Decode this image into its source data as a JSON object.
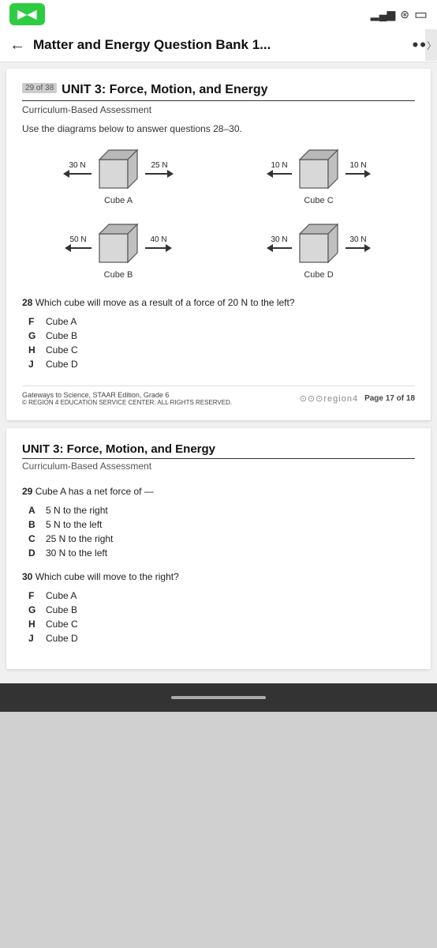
{
  "statusBar": {
    "videoLabel": "▶◀",
    "signal": "▂▄▆",
    "wifi": "⇡",
    "battery": "▭"
  },
  "navBar": {
    "backArrow": "←",
    "title": "Matter and Energy Question Bank 1...",
    "dots": "••",
    "chevron": "〉"
  },
  "page1": {
    "pageBadge": "29 of 38",
    "unitTitle": "UNIT 3: Force, Motion, and Energy",
    "subtitle": "Curriculum-Based Assessment",
    "instructions": "Use the diagrams below to answer questions 28–30.",
    "cubeA": {
      "label": "Cube A",
      "leftForce": "30 N",
      "rightForce": "25 N"
    },
    "cubeC": {
      "label": "Cube C",
      "leftForce": "10 N",
      "rightForce": "10 N"
    },
    "cubeB": {
      "label": "Cube B",
      "leftForce": "50 N",
      "rightForce": "40 N"
    },
    "cubeD": {
      "label": "Cube D",
      "leftForce": "30 N",
      "rightForce": "30 N"
    },
    "q28": {
      "num": "28",
      "text": "Which cube will move as a result of a force of 20 N to the left?",
      "options": [
        {
          "letter": "F",
          "text": "Cube A"
        },
        {
          "letter": "G",
          "text": "Cube B"
        },
        {
          "letter": "H",
          "text": "Cube C"
        },
        {
          "letter": "J",
          "text": "Cube D"
        }
      ]
    },
    "footer": {
      "left": "Gateways to Science, STAAR Edition, Grade 6",
      "copy": "© REGION 4 EDUCATION SERVICE CENTER. ALL RIGHTS RESERVED.",
      "logo": "⊙⊙⊙region4",
      "pageNum": "Page 17 of 18"
    }
  },
  "page2": {
    "unitTitle": "UNIT 3: Force, Motion, and Energy",
    "subtitle": "Curriculum-Based Assessment",
    "q29": {
      "num": "29",
      "text": "Cube A has a net force of —",
      "options": [
        {
          "letter": "A",
          "text": "5 N to the right"
        },
        {
          "letter": "B",
          "text": "5 N to the left"
        },
        {
          "letter": "C",
          "text": "25 N to the right"
        },
        {
          "letter": "D",
          "text": "30 N to the left"
        }
      ]
    },
    "q30": {
      "num": "30",
      "text": "Which cube will move to the right?",
      "options": [
        {
          "letter": "F",
          "text": "Cube A"
        },
        {
          "letter": "G",
          "text": "Cube B"
        },
        {
          "letter": "H",
          "text": "Cube C"
        },
        {
          "letter": "J",
          "text": "Cube D"
        }
      ]
    }
  },
  "bottomBar": {}
}
